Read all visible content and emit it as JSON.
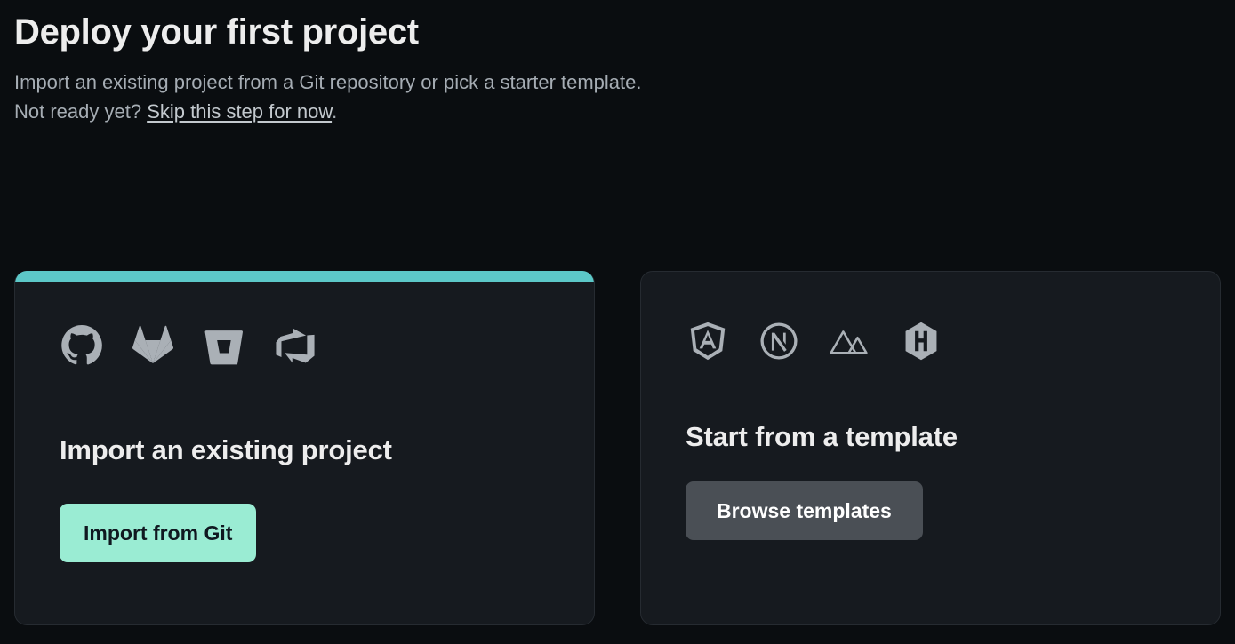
{
  "header": {
    "title": "Deploy your first project",
    "subtitle_line1": "Import an existing project from a Git repository or pick a starter template.",
    "subtitle_line2_prefix": "Not ready yet? ",
    "skip_link_label": "Skip this step for now",
    "subtitle_line2_suffix": "."
  },
  "theme": {
    "background": "#0a0d10",
    "card_background": "#161a1f",
    "card_border": "#262b31",
    "accent_bar": "#5cc8c8",
    "primary_button_bg": "#9aecd3",
    "primary_button_text": "#101820",
    "secondary_button_bg": "#4a4f55",
    "secondary_button_text": "#ffffff",
    "heading_text": "#ededed",
    "body_text": "#a6adb4",
    "icon_color": "#aab0b6"
  },
  "cards": [
    {
      "id": "import-existing-project",
      "has_accent_bar": true,
      "heading": "Import an existing project",
      "button_label": "Import from Git",
      "button_style": "primary",
      "icons": [
        {
          "name": "github-icon",
          "label": "GitHub"
        },
        {
          "name": "gitlab-icon",
          "label": "GitLab"
        },
        {
          "name": "bitbucket-icon",
          "label": "Bitbucket"
        },
        {
          "name": "azure-devops-icon",
          "label": "Azure DevOps"
        }
      ]
    },
    {
      "id": "start-from-template",
      "has_accent_bar": false,
      "heading": "Start from a template",
      "button_label": "Browse templates",
      "button_style": "secondary",
      "icons": [
        {
          "name": "angular-icon",
          "label": "Angular"
        },
        {
          "name": "nextjs-icon",
          "label": "Next.js"
        },
        {
          "name": "nuxt-icon",
          "label": "Nuxt"
        },
        {
          "name": "hugo-icon",
          "label": "Hugo"
        }
      ]
    }
  ]
}
